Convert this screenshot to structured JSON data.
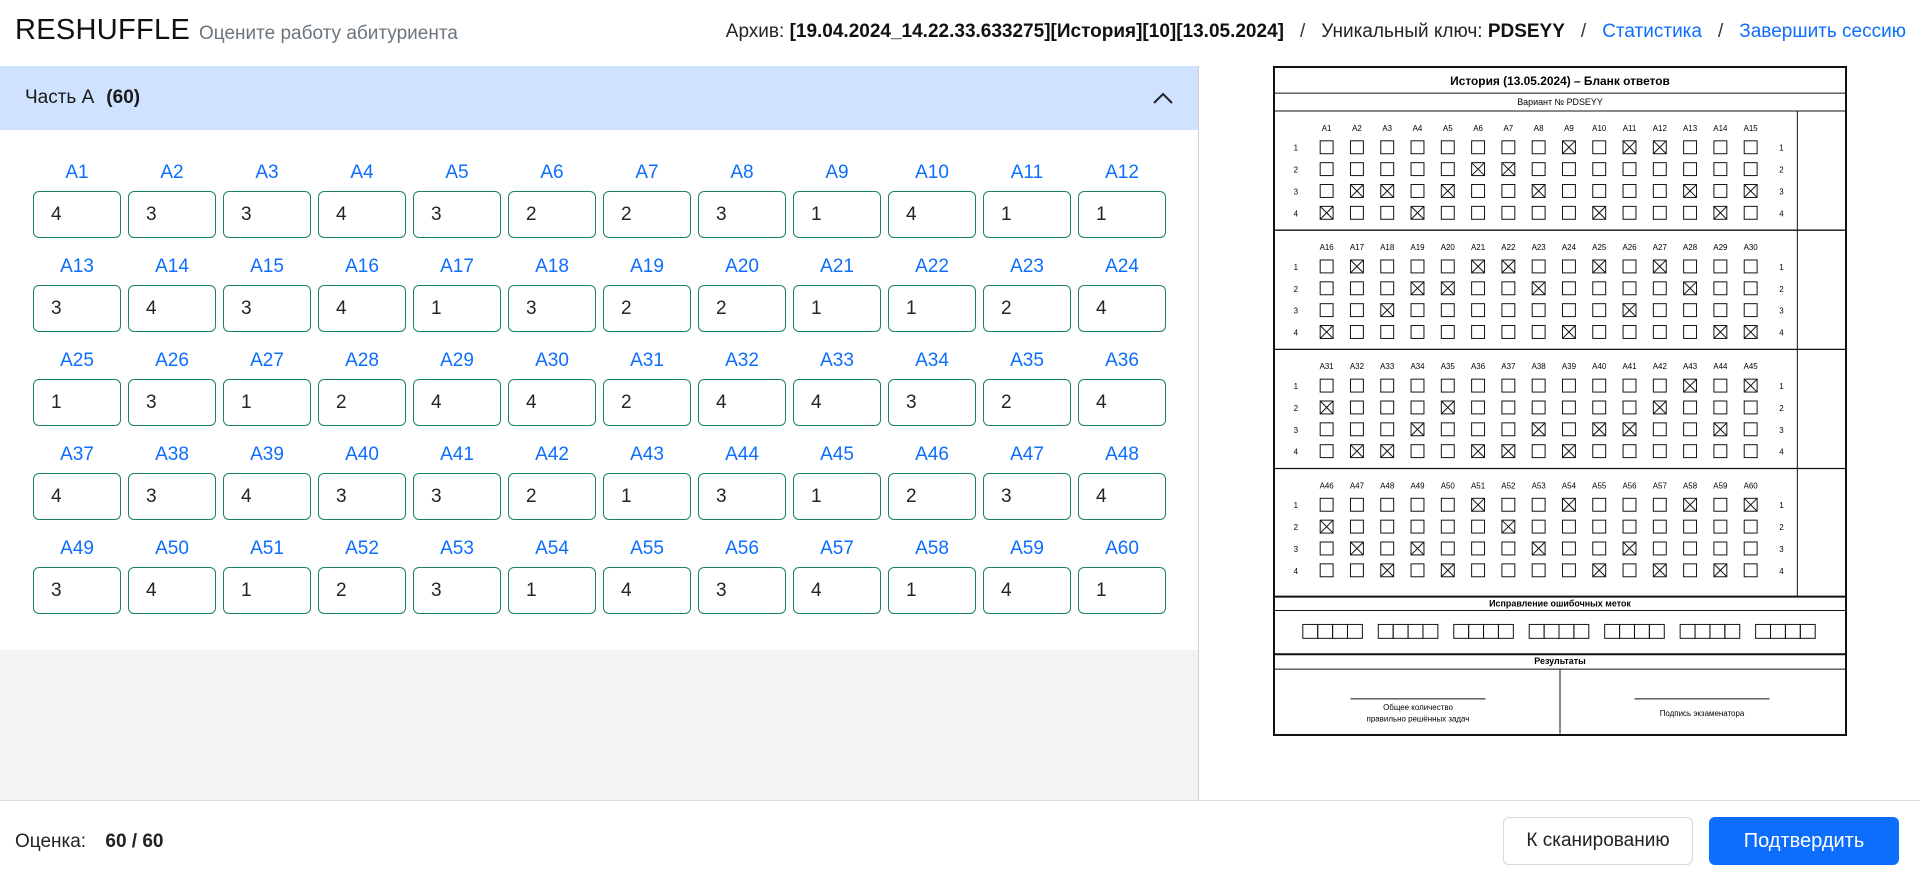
{
  "header": {
    "brand": "RESHUFFLE",
    "subtitle": "Оцените работу абитуриента",
    "archive_label": "Архив:",
    "archive_value": "[19.04.2024_14.22.33.633275][История][10][13.05.2024]",
    "separator": "/",
    "key_label": "Уникальный ключ:",
    "key_value": "PDSEYY",
    "stats_link": "Статистика",
    "end_session_link": "Завершить сессию"
  },
  "section": {
    "title": "Часть А",
    "count": "(60)"
  },
  "answers": [
    {
      "label": "A1",
      "value": "4"
    },
    {
      "label": "A2",
      "value": "3"
    },
    {
      "label": "A3",
      "value": "3"
    },
    {
      "label": "A4",
      "value": "4"
    },
    {
      "label": "A5",
      "value": "3"
    },
    {
      "label": "A6",
      "value": "2"
    },
    {
      "label": "A7",
      "value": "2"
    },
    {
      "label": "A8",
      "value": "3"
    },
    {
      "label": "A9",
      "value": "1"
    },
    {
      "label": "A10",
      "value": "4"
    },
    {
      "label": "A11",
      "value": "1"
    },
    {
      "label": "A12",
      "value": "1"
    },
    {
      "label": "A13",
      "value": "3"
    },
    {
      "label": "A14",
      "value": "4"
    },
    {
      "label": "A15",
      "value": "3"
    },
    {
      "label": "A16",
      "value": "4"
    },
    {
      "label": "A17",
      "value": "1"
    },
    {
      "label": "A18",
      "value": "3"
    },
    {
      "label": "A19",
      "value": "2"
    },
    {
      "label": "A20",
      "value": "2"
    },
    {
      "label": "A21",
      "value": "1"
    },
    {
      "label": "A22",
      "value": "1"
    },
    {
      "label": "A23",
      "value": "2"
    },
    {
      "label": "A24",
      "value": "4"
    },
    {
      "label": "A25",
      "value": "1"
    },
    {
      "label": "A26",
      "value": "3"
    },
    {
      "label": "A27",
      "value": "1"
    },
    {
      "label": "A28",
      "value": "2"
    },
    {
      "label": "A29",
      "value": "4"
    },
    {
      "label": "A30",
      "value": "4"
    },
    {
      "label": "A31",
      "value": "2"
    },
    {
      "label": "A32",
      "value": "4"
    },
    {
      "label": "A33",
      "value": "4"
    },
    {
      "label": "A34",
      "value": "3"
    },
    {
      "label": "A35",
      "value": "2"
    },
    {
      "label": "A36",
      "value": "4"
    },
    {
      "label": "A37",
      "value": "4"
    },
    {
      "label": "A38",
      "value": "3"
    },
    {
      "label": "A39",
      "value": "4"
    },
    {
      "label": "A40",
      "value": "3"
    },
    {
      "label": "A41",
      "value": "3"
    },
    {
      "label": "A42",
      "value": "2"
    },
    {
      "label": "A43",
      "value": "1"
    },
    {
      "label": "A44",
      "value": "3"
    },
    {
      "label": "A45",
      "value": "1"
    },
    {
      "label": "A46",
      "value": "2"
    },
    {
      "label": "A47",
      "value": "3"
    },
    {
      "label": "A48",
      "value": "4"
    },
    {
      "label": "A49",
      "value": "3"
    },
    {
      "label": "A50",
      "value": "4"
    },
    {
      "label": "A51",
      "value": "1"
    },
    {
      "label": "A52",
      "value": "2"
    },
    {
      "label": "A53",
      "value": "3"
    },
    {
      "label": "A54",
      "value": "1"
    },
    {
      "label": "A55",
      "value": "4"
    },
    {
      "label": "A56",
      "value": "3"
    },
    {
      "label": "A57",
      "value": "4"
    },
    {
      "label": "A58",
      "value": "1"
    },
    {
      "label": "A59",
      "value": "4"
    },
    {
      "label": "A60",
      "value": "1"
    }
  ],
  "scan": {
    "title": "История (13.05.2024) – Бланк ответов",
    "variant": "Вариант № PDSEYY",
    "row_numbers": [
      "1",
      "2",
      "3",
      "4"
    ],
    "blocks": [
      {
        "headers": [
          "A1",
          "A2",
          "A3",
          "A4",
          "A5",
          "A6",
          "A7",
          "A8",
          "A9",
          "A10",
          "A11",
          "A12",
          "A13",
          "A14",
          "A15"
        ],
        "marks": [
          4,
          3,
          3,
          4,
          3,
          2,
          2,
          3,
          1,
          4,
          1,
          1,
          3,
          4,
          3
        ]
      },
      {
        "headers": [
          "A16",
          "A17",
          "A18",
          "A19",
          "A20",
          "A21",
          "A22",
          "A23",
          "A24",
          "A25",
          "A26",
          "A27",
          "A28",
          "A29",
          "A30"
        ],
        "marks": [
          4,
          1,
          3,
          2,
          2,
          1,
          1,
          2,
          4,
          1,
          3,
          1,
          2,
          4,
          4
        ]
      },
      {
        "headers": [
          "A31",
          "A32",
          "A33",
          "A34",
          "A35",
          "A36",
          "A37",
          "A38",
          "A39",
          "A40",
          "A41",
          "A42",
          "A43",
          "A44",
          "A45"
        ],
        "marks": [
          2,
          4,
          4,
          3,
          2,
          4,
          4,
          3,
          4,
          3,
          3,
          2,
          1,
          3,
          1
        ]
      },
      {
        "headers": [
          "A46",
          "A47",
          "A48",
          "A49",
          "A50",
          "A51",
          "A52",
          "A53",
          "A54",
          "A55",
          "A56",
          "A57",
          "A58",
          "A59",
          "A60"
        ],
        "marks": [
          2,
          3,
          4,
          3,
          4,
          1,
          2,
          3,
          1,
          4,
          3,
          4,
          1,
          4,
          1
        ]
      }
    ],
    "corrections_title": "Исправление ошибочных меток",
    "results_title": "Результаты",
    "total_label_line1": "Общее количество",
    "total_label_line2": "правильно решённых задач",
    "signature_label": "Подпись экзаменатора"
  },
  "footer": {
    "score_label": "Оценка:",
    "score_value": "60 / 60",
    "scan_button": "К сканированию",
    "confirm_button": "Подтвердить"
  }
}
